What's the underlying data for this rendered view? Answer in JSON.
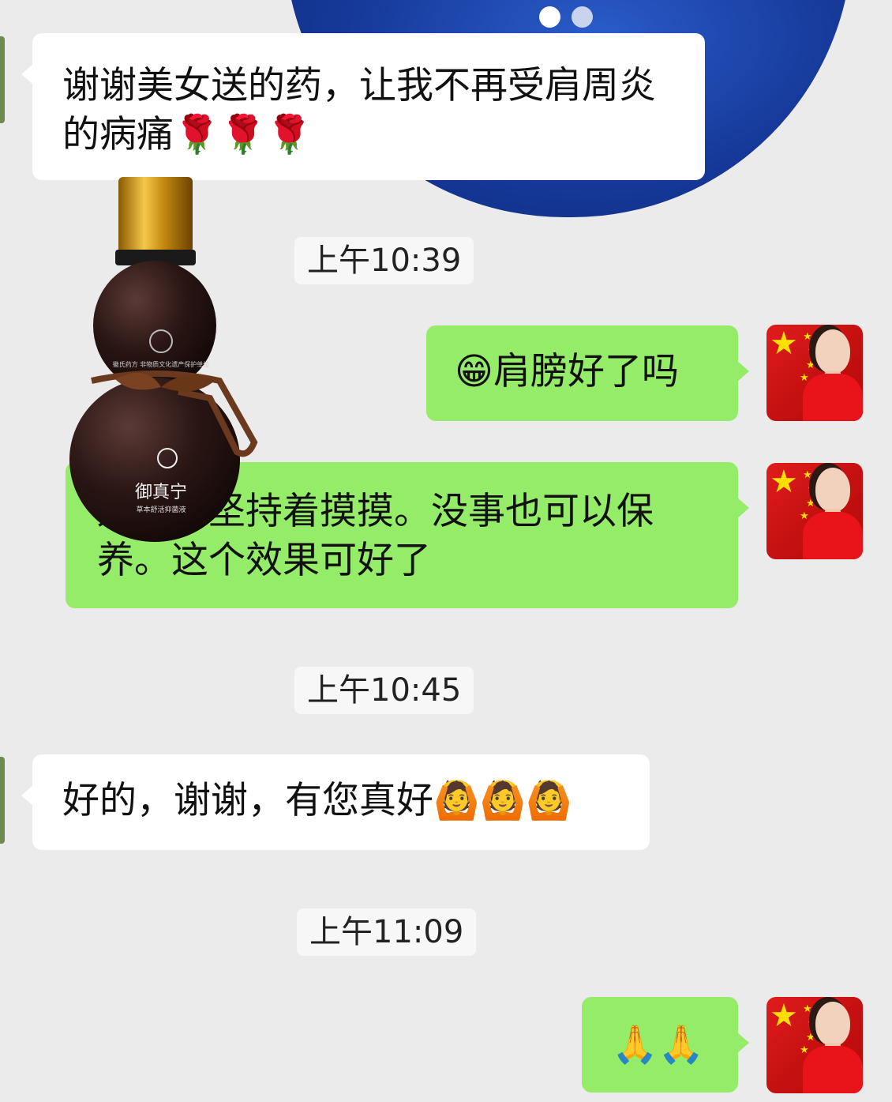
{
  "messages": [
    {
      "side": "in",
      "text": "谢谢美女送的药，让我不再受肩周炎的病痛🌹🌹🌹"
    },
    {
      "side": "out",
      "text": "😁肩膀好了吗"
    },
    {
      "side": "out",
      "text": "好，你坚持着摸摸。没事也可以保养。这个效果可好了"
    },
    {
      "side": "in",
      "text": "好的，谢谢，有您真好🙆🙆🙆"
    },
    {
      "side": "out",
      "text": "🙏🙏"
    }
  ],
  "timestamps": [
    "上午10:39",
    "上午10:45",
    "上午11:09"
  ],
  "image": {
    "product_name": "御真宁",
    "product_sub": "草本舒活抑菌液",
    "label_small": "徽氏药方 非物质文化遗产保护单位"
  },
  "colors": {
    "bubble_out": "#95ec69",
    "bubble_in": "#ffffff",
    "background": "#ebebeb"
  }
}
